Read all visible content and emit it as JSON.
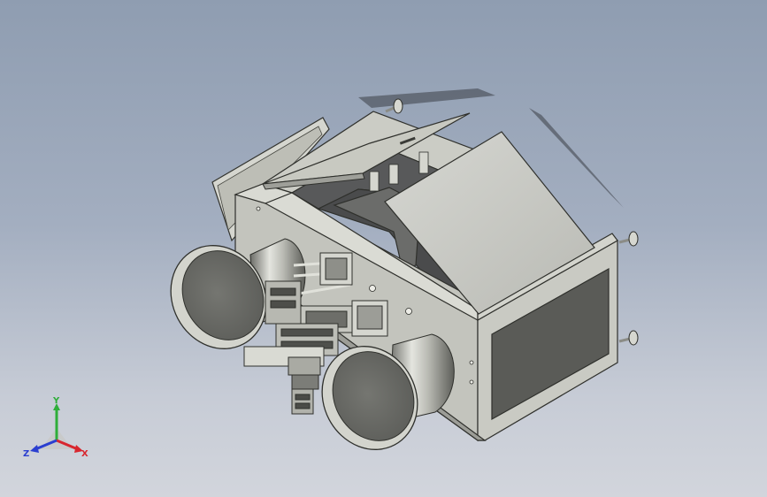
{
  "viewport": {
    "background_top": "#8f9db1",
    "background_bottom": "#d2d5dc"
  },
  "model": {
    "body_color": "#c8c9c1",
    "panel_color": "#5a5b57",
    "shadow_color": "#3a3e46"
  },
  "triad": {
    "x_label": "X",
    "y_label": "Y",
    "z_label": "Z",
    "x_color": "#d8262e",
    "y_color": "#2fae3a",
    "z_color": "#2b3fd0"
  }
}
